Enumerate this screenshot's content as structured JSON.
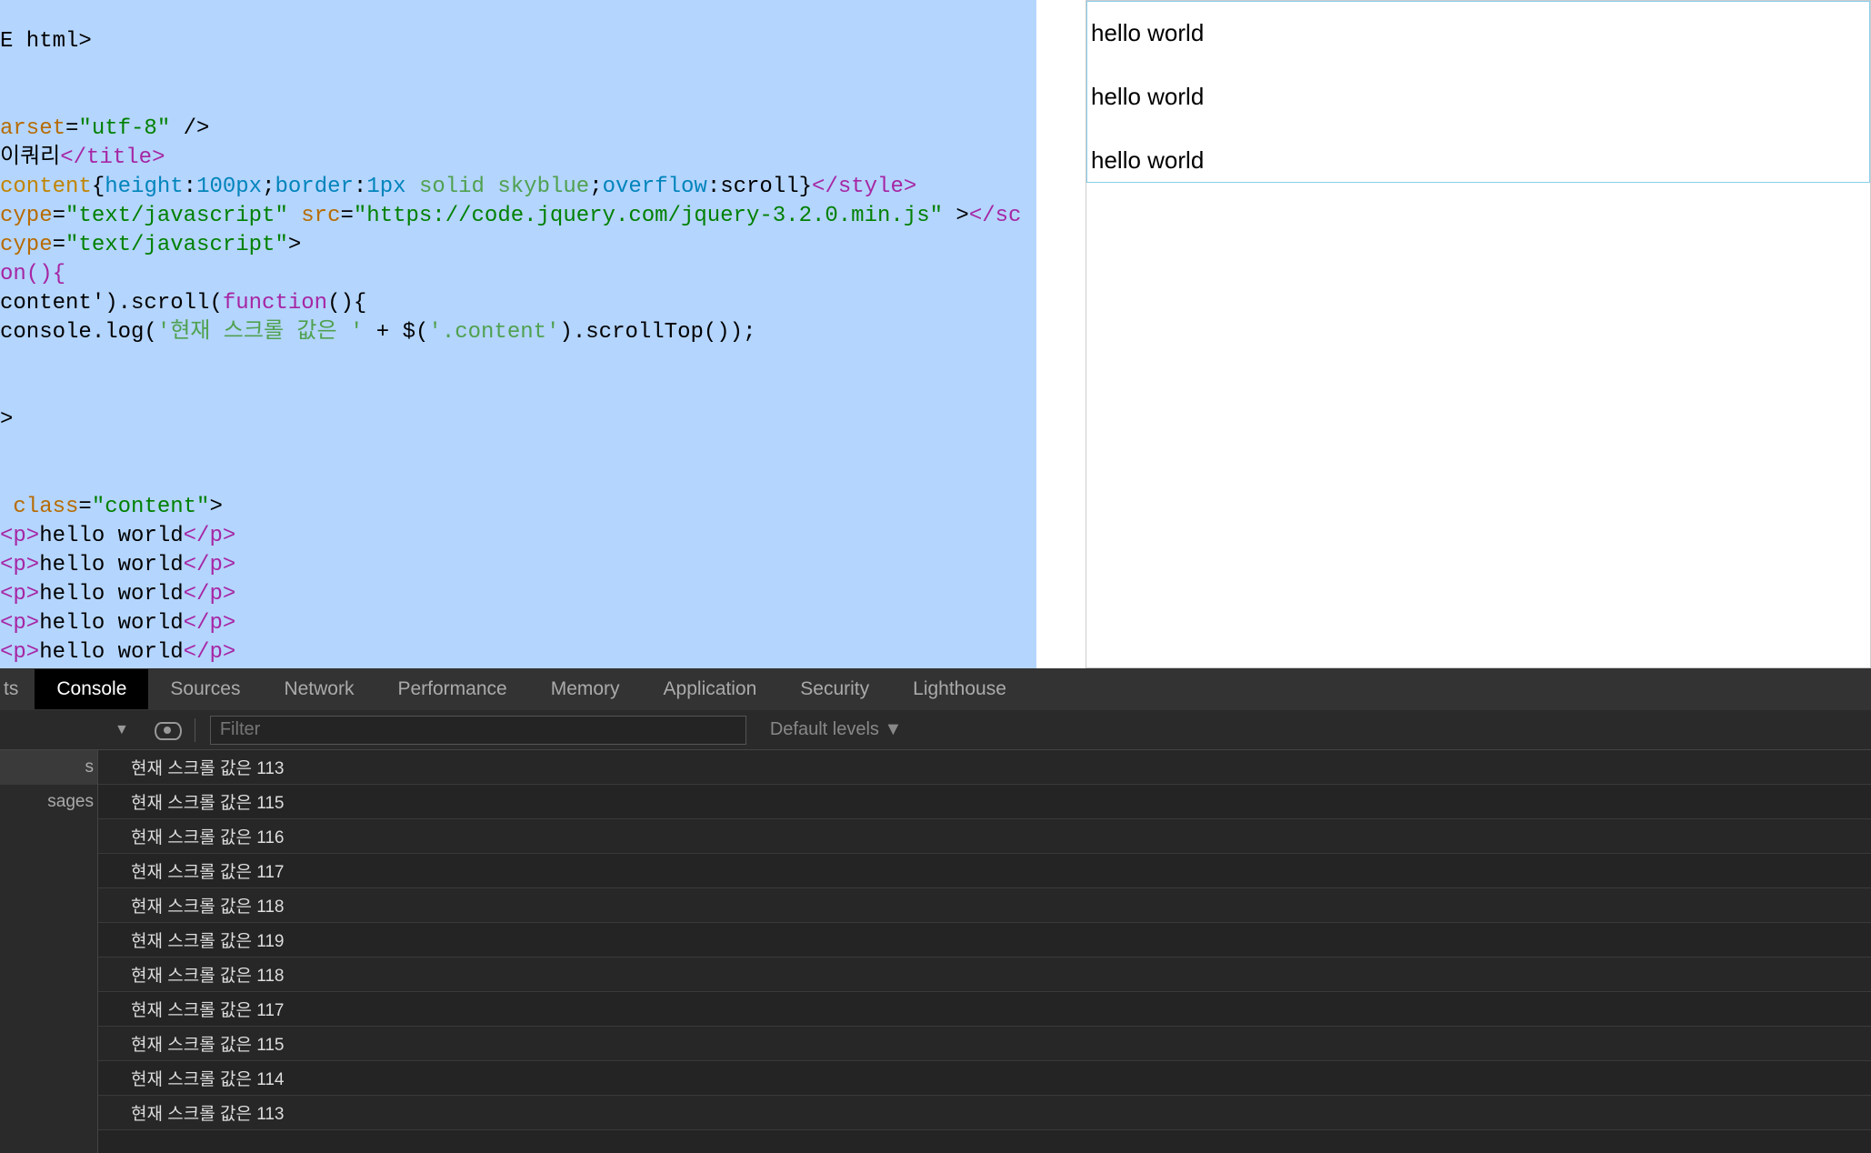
{
  "code": {
    "l1": "E html>",
    "l2_attr": "arset",
    "l2_val": "\"utf-8\"",
    "l2_close": " />",
    "l3_text": "이쿼리",
    "l3_close": "</title>",
    "l4_sel": "content",
    "l4_p1": "height",
    "l4_v1": "100px",
    "l4_p2": "border",
    "l4_v2_a": "1px",
    "l4_v2_b": "solid",
    "l4_v2_c": "skyblue",
    "l4_p3": "overflow",
    "l4_v3": "scroll",
    "l4_close": "</style>",
    "l5_attr1": "cype",
    "l5_val1": "\"text/javascript\"",
    "l5_attr2": "src",
    "l5_val2": "\"https://code.jquery.com/jquery-3.2.0.min.js\"",
    "l5_mid": " >",
    "l5_close": "</sc",
    "l6_attr": "cype",
    "l6_val": "\"text/javascript\"",
    "l6_close": ">",
    "l7": "on(){",
    "l8_a": "content').scroll(",
    "l8_fn": "function",
    "l8_b": "(){",
    "l9_a": "console.log(",
    "l9_str": "'현재 스크롤 값은 '",
    "l9_b": " + $(",
    "l9_str2": "'.content'",
    "l9_c": ").scrollTop());",
    "l10": ">",
    "l11_attr": "class",
    "l11_val": "\"content\"",
    "l11_close": ">",
    "ptext": "hello world",
    "popen": "<p>",
    "pclose": "</p>"
  },
  "preview": {
    "lines": [
      "hello world",
      "hello world",
      "hello world"
    ]
  },
  "devtools": {
    "tabs": {
      "first_partial": "ts",
      "console": "Console",
      "sources": "Sources",
      "network": "Network",
      "performance": "Performance",
      "memory": "Memory",
      "application": "Application",
      "security": "Security",
      "lighthouse": "Lighthouse"
    },
    "filter_placeholder": "Filter",
    "levels": "Default levels ▼",
    "sidebar": {
      "item1": "s",
      "item2": "sages"
    },
    "logs": [
      "현재 스크롤 값은 113",
      "현재 스크롤 값은 115",
      "현재 스크롤 값은 116",
      "현재 스크롤 값은 117",
      "현재 스크롤 값은 118",
      "현재 스크롤 값은 119",
      "현재 스크롤 값은 118",
      "현재 스크롤 값은 117",
      "현재 스크롤 값은 115",
      "현재 스크롤 값은 114",
      "현재 스크롤 값은 113"
    ]
  }
}
